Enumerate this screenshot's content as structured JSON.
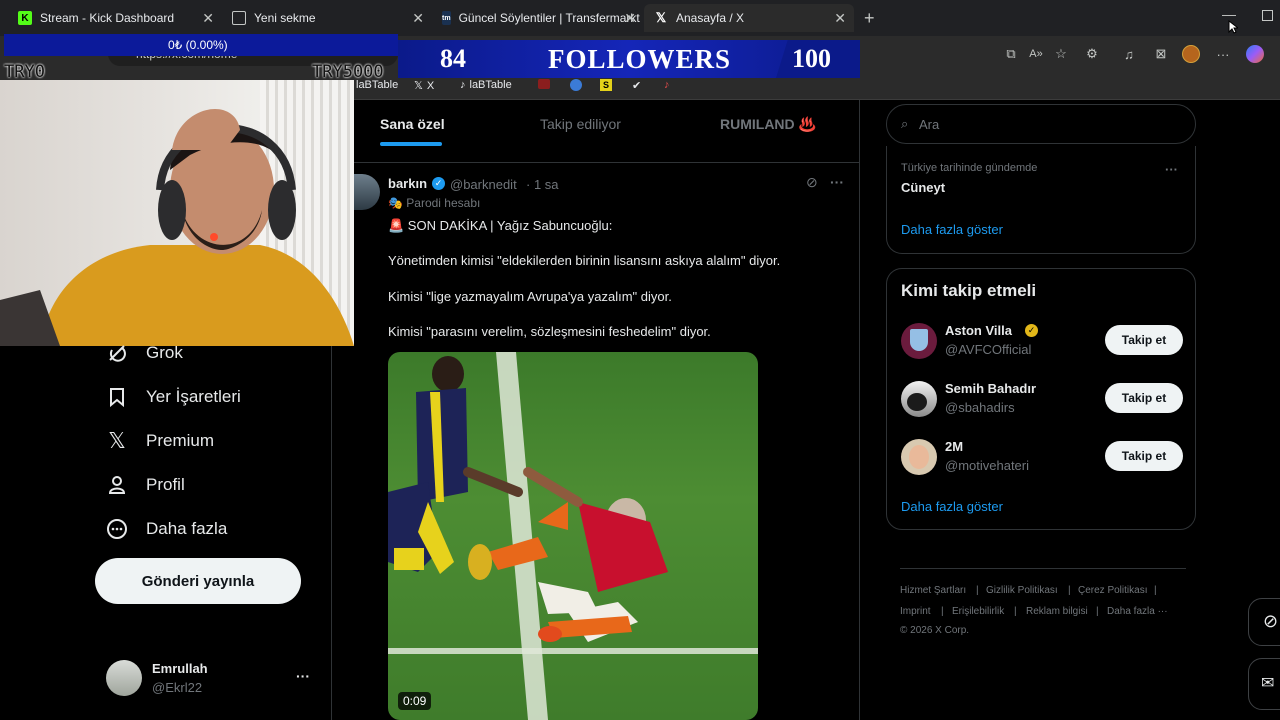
{
  "browser": {
    "tabs": [
      {
        "label": "Stream - Kick Dashboard",
        "icon": "kick-icon",
        "active": false
      },
      {
        "label": "Yeni sekme",
        "icon": "new-tab-icon",
        "active": false
      },
      {
        "label": "Güncel Söylentiler | Transfermarkt",
        "icon": "transfermarkt-icon",
        "active": false
      },
      {
        "label": "Anasayfa / X",
        "icon": "x-logo-icon",
        "active": true
      }
    ],
    "new_tab_symbol": "+",
    "address": "https://x.com/home",
    "bookmarks": [
      "laBTable",
      "X",
      "laBTable"
    ]
  },
  "overlay": {
    "donation_progress": "0₺ (0.00%)",
    "donation_start": "TRY0",
    "donation_goal": "TRY5000",
    "followers_current": "84",
    "followers_label": "FOLLOWERS",
    "followers_goal": "100"
  },
  "nav": {
    "items": [
      {
        "label": "Grok",
        "icon": "grok-icon"
      },
      {
        "label": "Yer İşaretleri",
        "icon": "bookmark-icon"
      },
      {
        "label": "Premium",
        "icon": "x-premium-icon"
      },
      {
        "label": "Profil",
        "icon": "profile-icon"
      },
      {
        "label": "Daha fazla",
        "icon": "more-circle-icon"
      }
    ],
    "post_button": "Gönderi yayınla",
    "account": {
      "name": "Emrullah",
      "handle": "@Ekrl22",
      "more": "···"
    }
  },
  "feed": {
    "tabs": [
      "Sana özel",
      "Takip ediliyor",
      "RUMILAND ♨️"
    ],
    "tweet": {
      "name": "barkın",
      "handle": "@barknedit",
      "time": "· 1 sa",
      "parody_label": "Parodi hesabı",
      "lines": [
        "🚨 SON DAKİKA | Yağız Sabuncuoğlu:",
        "Yönetimden kimisi \"eldekilerden birinin lisansını askıya alalım\" diyor.",
        "Kimisi \"lige yazmayalım Avrupa'ya yazalım\" diyor.",
        "Kimisi \"parasını verelim, sözleşmesini feshedelim\" diyor."
      ],
      "video_duration": "0:09"
    }
  },
  "sidebar": {
    "search_placeholder": "Ara",
    "trend": {
      "context": "Türkiye tarihinde gündemde",
      "title": "Cüneyt"
    },
    "show_more": "Daha fazla göster",
    "who_to_follow": {
      "title": "Kimi takip etmeli",
      "accounts": [
        {
          "name": "Aston Villa",
          "handle": "@AVFCOfficial",
          "button": "Takip et"
        },
        {
          "name": "Semih Bahadır",
          "handle": "@sbahadirs",
          "button": "Takip et"
        },
        {
          "name": "2M",
          "handle": "@motivehateri",
          "button": "Takip et"
        }
      ],
      "show_more": "Daha fazla göster"
    },
    "footer": {
      "links": [
        "Hizmet Şartları",
        "Gizlilik Politikası",
        "Çerez Politikası",
        "Imprint",
        "Erişilebilirlik",
        "Reklam bilgisi",
        "Daha fazla ···"
      ],
      "copyright": "© 2026 X Corp."
    }
  },
  "colors": {
    "accent": "#1d9bf0",
    "background": "#000000",
    "overlay_blue": "#1526b8",
    "verified_gold": "#e2b719"
  }
}
